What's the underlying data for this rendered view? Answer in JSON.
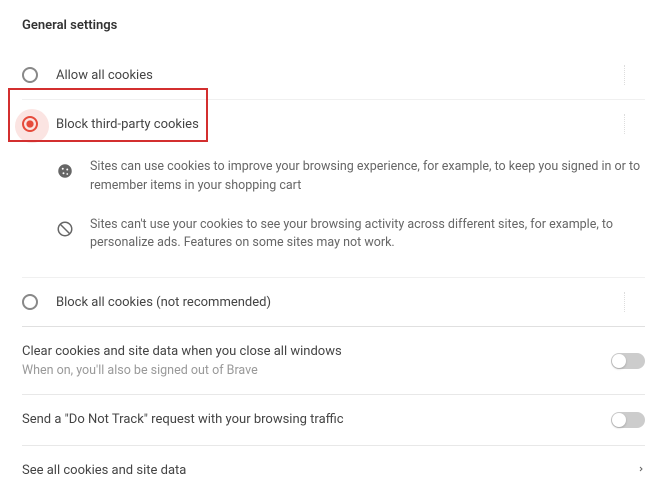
{
  "section_title": "General settings",
  "options": {
    "allow_all": {
      "label": "Allow all cookies"
    },
    "block_third_party": {
      "label": "Block third-party cookies"
    },
    "block_all": {
      "label": "Block all cookies (not recommended)"
    }
  },
  "details": {
    "allowed": "Sites can use cookies to improve your browsing experience, for example, to keep you signed in or to remember items in your shopping cart",
    "blocked": "Sites can't use your cookies to see your browsing activity across different sites, for example, to personalize ads. Features on some sites may not work."
  },
  "settings": {
    "clear_on_close": {
      "label": "Clear cookies and site data when you close all windows",
      "sub": "When on, you'll also be signed out of Brave"
    },
    "dnt": {
      "label": "Send a \"Do Not Track\" request with your browsing traffic"
    },
    "see_all": {
      "label": "See all cookies and site data"
    }
  }
}
